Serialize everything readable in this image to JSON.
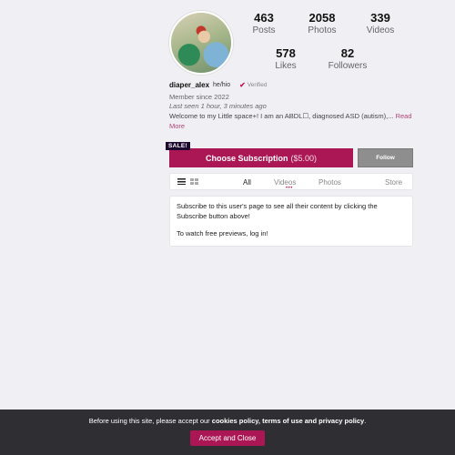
{
  "profile": {
    "stats": [
      {
        "value": "463",
        "label": "Posts"
      },
      {
        "value": "2058",
        "label": "Photos"
      },
      {
        "value": "339",
        "label": "Videos"
      },
      {
        "value": "578",
        "label": "Likes"
      },
      {
        "value": "82",
        "label": "Followers"
      }
    ],
    "username": "diaper_alex",
    "pronouns": "he/hio",
    "verified_label": "Verified",
    "member_since": "Member since 2022",
    "last_seen": "Last seen 1 hour, 3 minutes ago",
    "bio": "Welcome to my Little space+! I am an ABDL☐, diagnosed ASD (autism),...",
    "read_more": "Read More"
  },
  "actions": {
    "sale_badge": "SALE!",
    "subscribe_label": "Choose Subscription",
    "subscribe_price": "($5.00)",
    "follow_label": "Follow"
  },
  "tabs": {
    "items": [
      "All",
      "Videos",
      "Photos",
      "Store"
    ],
    "active": "All"
  },
  "notice": {
    "line1": "Subscribe to this user's page to see all their content by clicking the Subscribe button above!",
    "line2": "To watch free previews, log in!"
  },
  "cookie": {
    "prefix": "Before using this site, please accept our",
    "policies": "cookies policy, terms of use and privacy policy",
    "suffix": ".",
    "accept_label": "Accept and Close"
  },
  "colors": {
    "accent": "#ab1654",
    "background": "#f0eff4",
    "cookie_bar": "#2f2e33"
  }
}
